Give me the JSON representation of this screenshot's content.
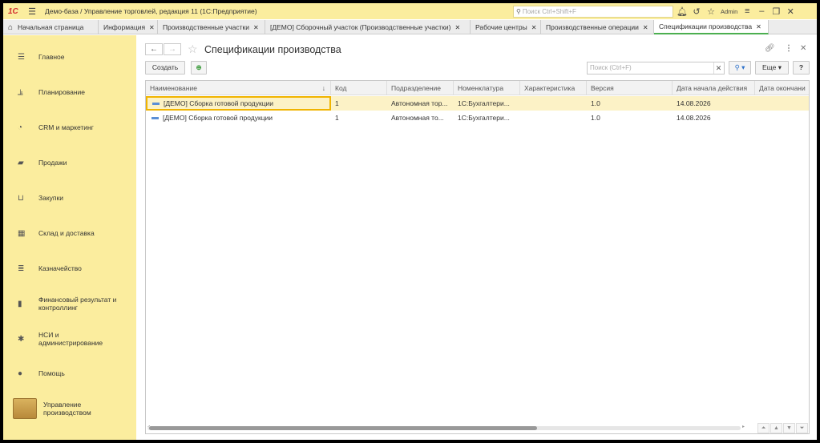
{
  "window": {
    "logo": "1С",
    "title": "Демо-база / Управление торговлей, редакция 11  (1С:Предприятие)",
    "search_placeholder": "Поиск Ctrl+Shift+F",
    "user": "Admin"
  },
  "tabs": [
    {
      "label": "Начальная страница",
      "closable": false
    },
    {
      "label": "Информация",
      "closable": true
    },
    {
      "label": "Производственные участки",
      "closable": true
    },
    {
      "label": "[ДЕМО] Сборочный участок (Производственные участки)",
      "closable": true
    },
    {
      "label": "Рабочие центры",
      "closable": true
    },
    {
      "label": "Производственные операции",
      "closable": true
    },
    {
      "label": "Спецификации производства",
      "closable": true,
      "active": true
    }
  ],
  "sidebar": {
    "items": [
      {
        "label": "Главное",
        "icon": "menu-icon"
      },
      {
        "label": "Планирование",
        "icon": "planning-icon"
      },
      {
        "label": "CRM и маркетинг",
        "icon": "pie-chart-icon"
      },
      {
        "label": "Продажи",
        "icon": "bag-icon"
      },
      {
        "label": "Закупки",
        "icon": "cart-icon"
      },
      {
        "label": "Склад и доставка",
        "icon": "warehouse-icon"
      },
      {
        "label": "Казначейство",
        "icon": "coins-icon"
      },
      {
        "label": "Финансовый результат и контроллинг",
        "icon": "bar-chart-icon"
      },
      {
        "label": "НСИ и администрирование",
        "icon": "gear-icon"
      },
      {
        "label": "Помощь",
        "icon": "help-icon"
      },
      {
        "label": "Управление производством",
        "icon": "factory-icon"
      }
    ]
  },
  "form": {
    "title": "Спецификации производства",
    "create_label": "Создать",
    "search_placeholder": "Поиск (Ctrl+F)",
    "more_label": "Еще",
    "help_label": "?"
  },
  "table": {
    "columns": [
      "Наименование",
      "Код",
      "Подразделение",
      "Номенклатура",
      "Характеристика",
      "Версия",
      "Дата начала действия",
      "Дата окончани"
    ],
    "rows": [
      {
        "name": "[ДЕМО] Сборка готовой продукции",
        "code": "1",
        "dept": "Автономная тор...",
        "nomen": "1С:Бухгалтери...",
        "char": "",
        "version": "1.0",
        "start": "14.08.2026",
        "end": ""
      },
      {
        "name": "[ДЕМО] Сборка готовой продукции",
        "code": "1",
        "dept": "Автономная то...",
        "nomen": "1С:Бухгалтери...",
        "char": "",
        "version": "1.0",
        "start": "14.08.2026",
        "end": ""
      }
    ]
  },
  "colors": {
    "accent": "#fbed9e",
    "selected_row": "#fcf2c6",
    "focus": "#f0b400",
    "active_tab": "#4caf50"
  }
}
